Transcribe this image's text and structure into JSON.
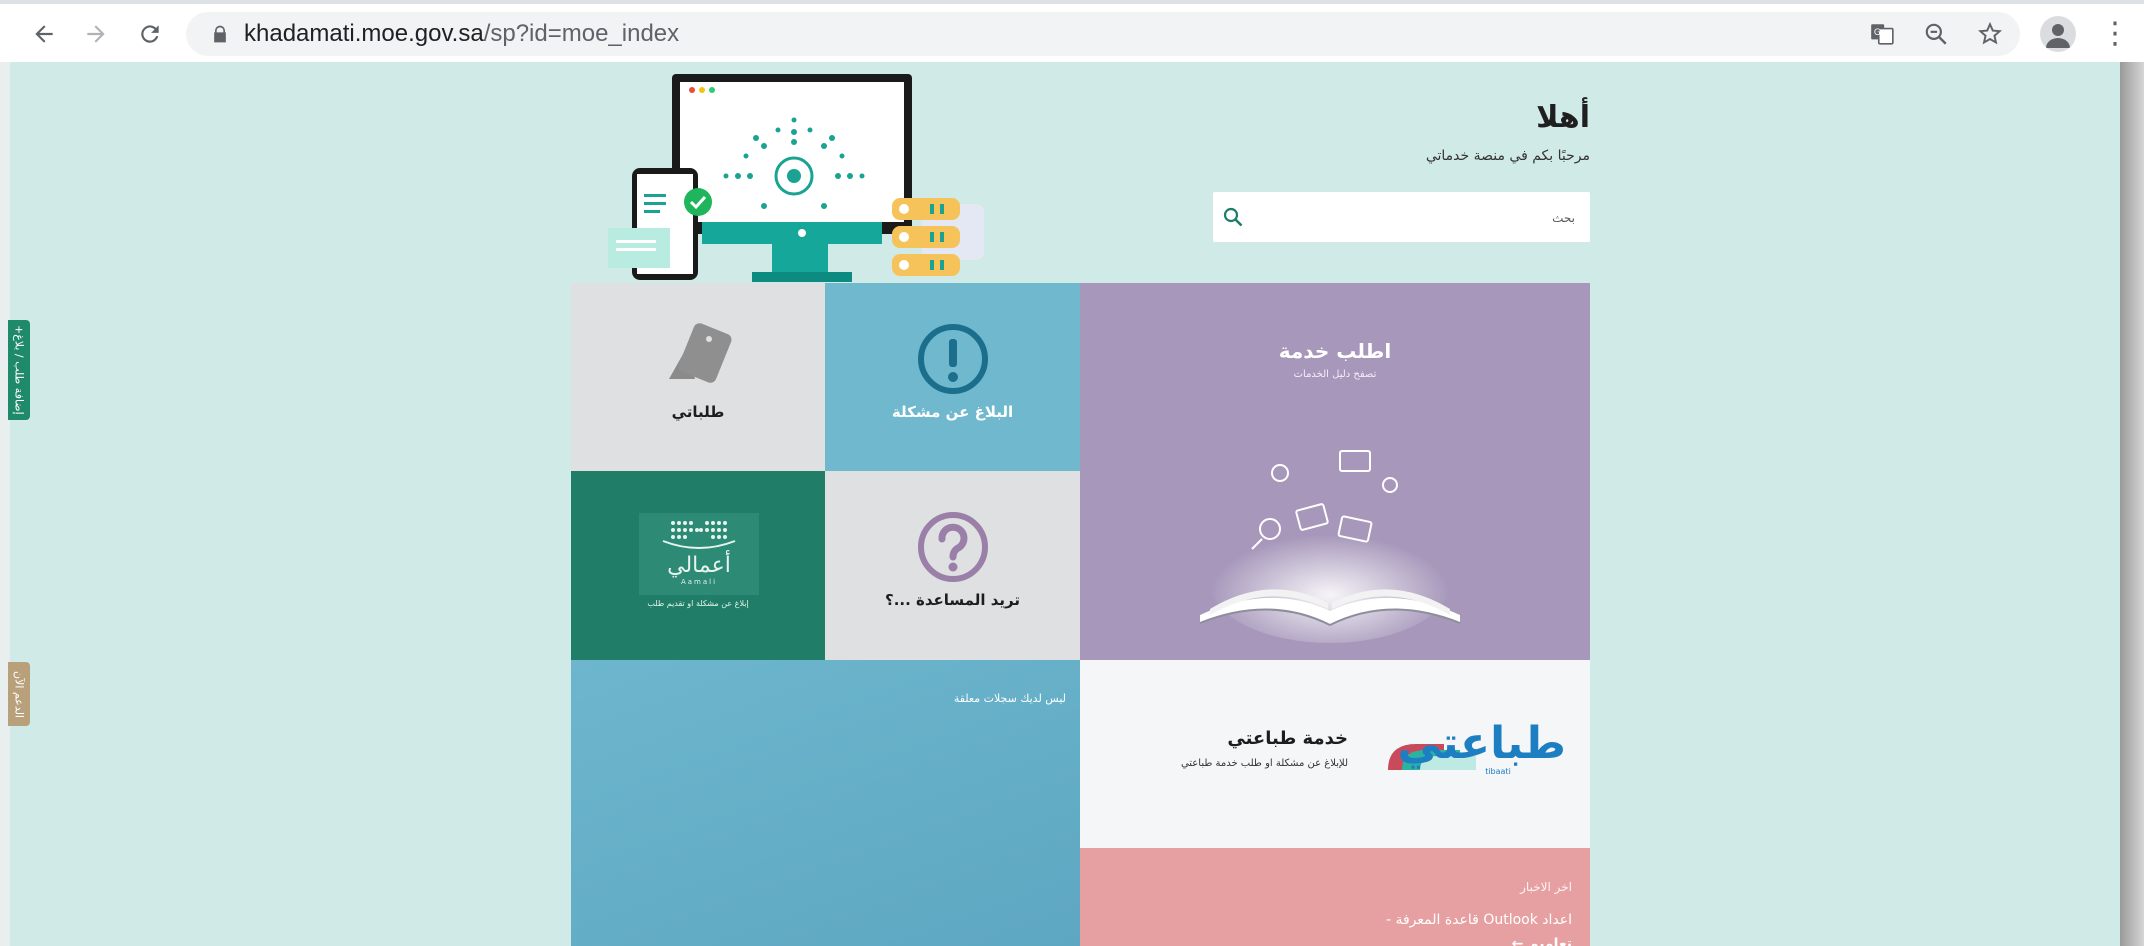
{
  "browser": {
    "url_host": "khadamati.moe.gov.sa",
    "url_path": "/sp?id=moe_index"
  },
  "side_tabs": {
    "green_label": "+إضافة طلب / بلاغ",
    "tan_label": "الدعم الآن"
  },
  "header": {
    "greeting": "أهلا",
    "welcome": "مرحبًا بكم في منصة خدماتي"
  },
  "search": {
    "placeholder": "بحث"
  },
  "tiles": {
    "request": {
      "title": "اطلب خدمة",
      "subtitle": "تصفح دليل الخدمات"
    },
    "report": {
      "label": "البلاغ عن مشكلة"
    },
    "orders": {
      "label": "طلباتي"
    },
    "help": {
      "label": "تريد المساعدة ...؟"
    },
    "aamali": {
      "logo_text": "أعمالي",
      "logo_latin": "Aamali",
      "label": "إبلاغ عن مشكلة او تقديم طلب"
    },
    "records": {
      "text": "ليس لديك سجلات معلقة"
    },
    "tibaati": {
      "title": "خدمة طباعتي",
      "subtitle": "للإبلاغ عن مشكلة او طلب خدمة طباعتي",
      "logo_text": "طباعتي",
      "logo_latin": "tibaati"
    },
    "news": {
      "heading": "اخر الاخبار",
      "item": "اعداد Outlook قاعدة المعرفة -",
      "item2": "تعاميم ←"
    }
  },
  "colors": {
    "page_bg": "#d0ebe7",
    "request_tile": "#a798bb",
    "report_tile": "#6fb8ce",
    "aamali_tile": "#207e68",
    "news_tile": "#e7a0a2"
  }
}
